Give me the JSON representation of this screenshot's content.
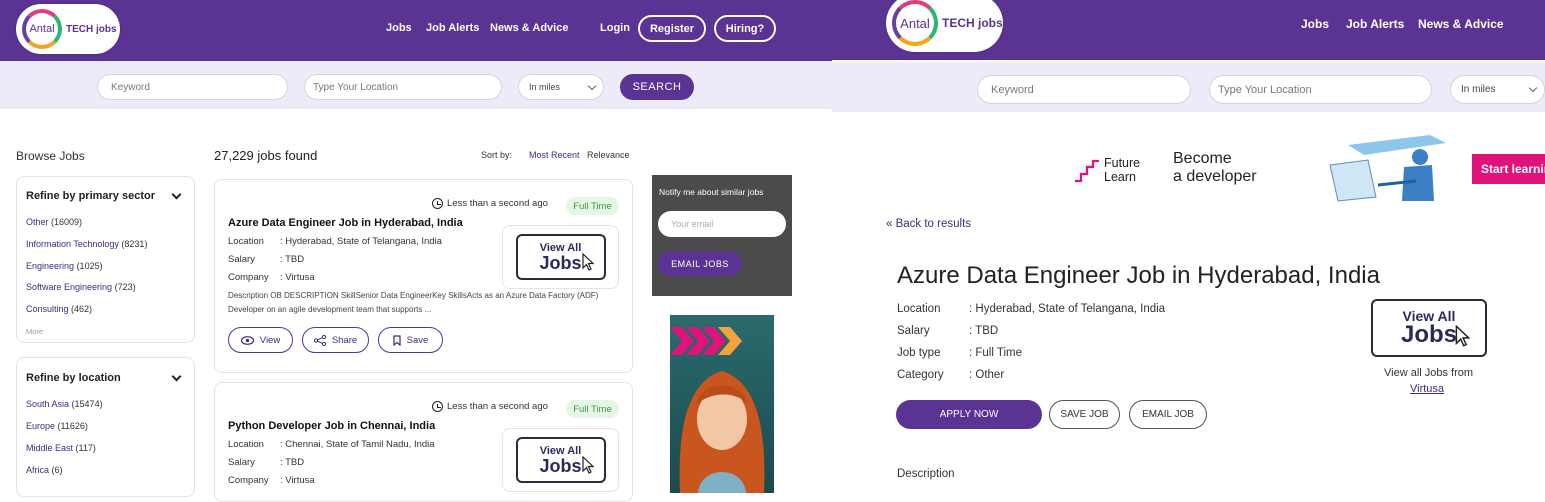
{
  "left": {
    "logo": {
      "brand": "Antal",
      "suffix": "TECH jobs"
    },
    "nav": [
      "Jobs",
      "Job Alerts",
      "News & Advice"
    ],
    "login": "Login",
    "register": "Register",
    "hiring": "Hiring?",
    "search": {
      "keyword_placeholder": "Keyword",
      "location_placeholder": "Type Your Location",
      "distance": "In miles",
      "button": "SEARCH"
    },
    "browse_title": "Browse Jobs",
    "results_count": "27,229 jobs found",
    "sort": {
      "label": "Sort by:",
      "recent": "Most Recent",
      "relevance": "Relevance"
    },
    "sector": {
      "title": "Refine by primary sector",
      "items": [
        {
          "name": "Other",
          "count": "(16009)"
        },
        {
          "name": "Information Technology",
          "count": "(8231)"
        },
        {
          "name": "Engineering",
          "count": "(1025)"
        },
        {
          "name": "Software Engineering",
          "count": "(723)"
        },
        {
          "name": "Consulting",
          "count": "(462)"
        }
      ],
      "more": "More"
    },
    "location_facet": {
      "title": "Refine by location",
      "items": [
        {
          "name": "South Asia",
          "count": "(15474)"
        },
        {
          "name": "Europe",
          "count": "(11626)"
        },
        {
          "name": "Middle East",
          "count": "(117)"
        },
        {
          "name": "Africa",
          "count": "(6)"
        }
      ]
    },
    "jobs": [
      {
        "time": "Less than a second ago",
        "badge": "Full Time",
        "title": "Azure Data Engineer Job in Hyderabad, India",
        "location_label": "Location",
        "location": ": Hyderabad, State of Telangana, India",
        "salary_label": "Salary",
        "salary": ": TBD",
        "company_label": "Company",
        "company": ": Virtusa",
        "desc_line1": "Description OB DESCRIPTION SkillSenior Data EngineerKey SkillsActs as an Azure Data Factory (ADF)",
        "desc_line2": "Developer on an agile development team that supports ...",
        "view": "View",
        "share": "Share",
        "save": "Save"
      },
      {
        "time": "Less than a second ago",
        "badge": "Full Time",
        "title": "Python Developer Job in Chennai, India",
        "location_label": "Location",
        "location": ": Chennai, State of Tamil Nadu, India",
        "salary_label": "Salary",
        "salary": ": TBD",
        "company_label": "Company",
        "company": ": Virtusa"
      }
    ],
    "view_all": {
      "small": "View All",
      "big": "Jobs"
    },
    "notify": {
      "title": "Notify me about similar jobs",
      "placeholder": "Your email",
      "button": "EMAIL JOBS"
    }
  },
  "right": {
    "logo": {
      "brand": "Antal",
      "suffix": "TECH jobs"
    },
    "nav": [
      "Jobs",
      "Job Alerts",
      "News & Advice"
    ],
    "search": {
      "keyword_placeholder": "Keyword",
      "location_placeholder": "Type Your Location",
      "distance": "In miles"
    },
    "banner": {
      "brand1": "Future",
      "brand2": "Learn",
      "headline1": "Become",
      "headline2": "a developer",
      "cta": "Start learnin"
    },
    "back": "« Back to results",
    "title": "Azure Data Engineer Job in Hyderabad, India",
    "details": [
      {
        "label": "Location",
        "value": ": Hyderabad, State of Telangana, India"
      },
      {
        "label": "Salary",
        "value": ": TBD"
      },
      {
        "label": "Job type",
        "value": ": Full Time"
      },
      {
        "label": "Category",
        "value": ": Other"
      }
    ],
    "apply": "APPLY NOW",
    "save_job": "SAVE JOB",
    "email_job": "EMAIL JOB",
    "view_all": {
      "small": "View All",
      "big": "Jobs"
    },
    "view_from": "View all Jobs from",
    "company": "Virtusa",
    "description_heading": "Description"
  },
  "colors": {
    "brand_purple": "#5a3393",
    "lavender": "#eeeaf7",
    "badge_green": "#3a9a3a",
    "cta_magenta": "#e0137a"
  }
}
